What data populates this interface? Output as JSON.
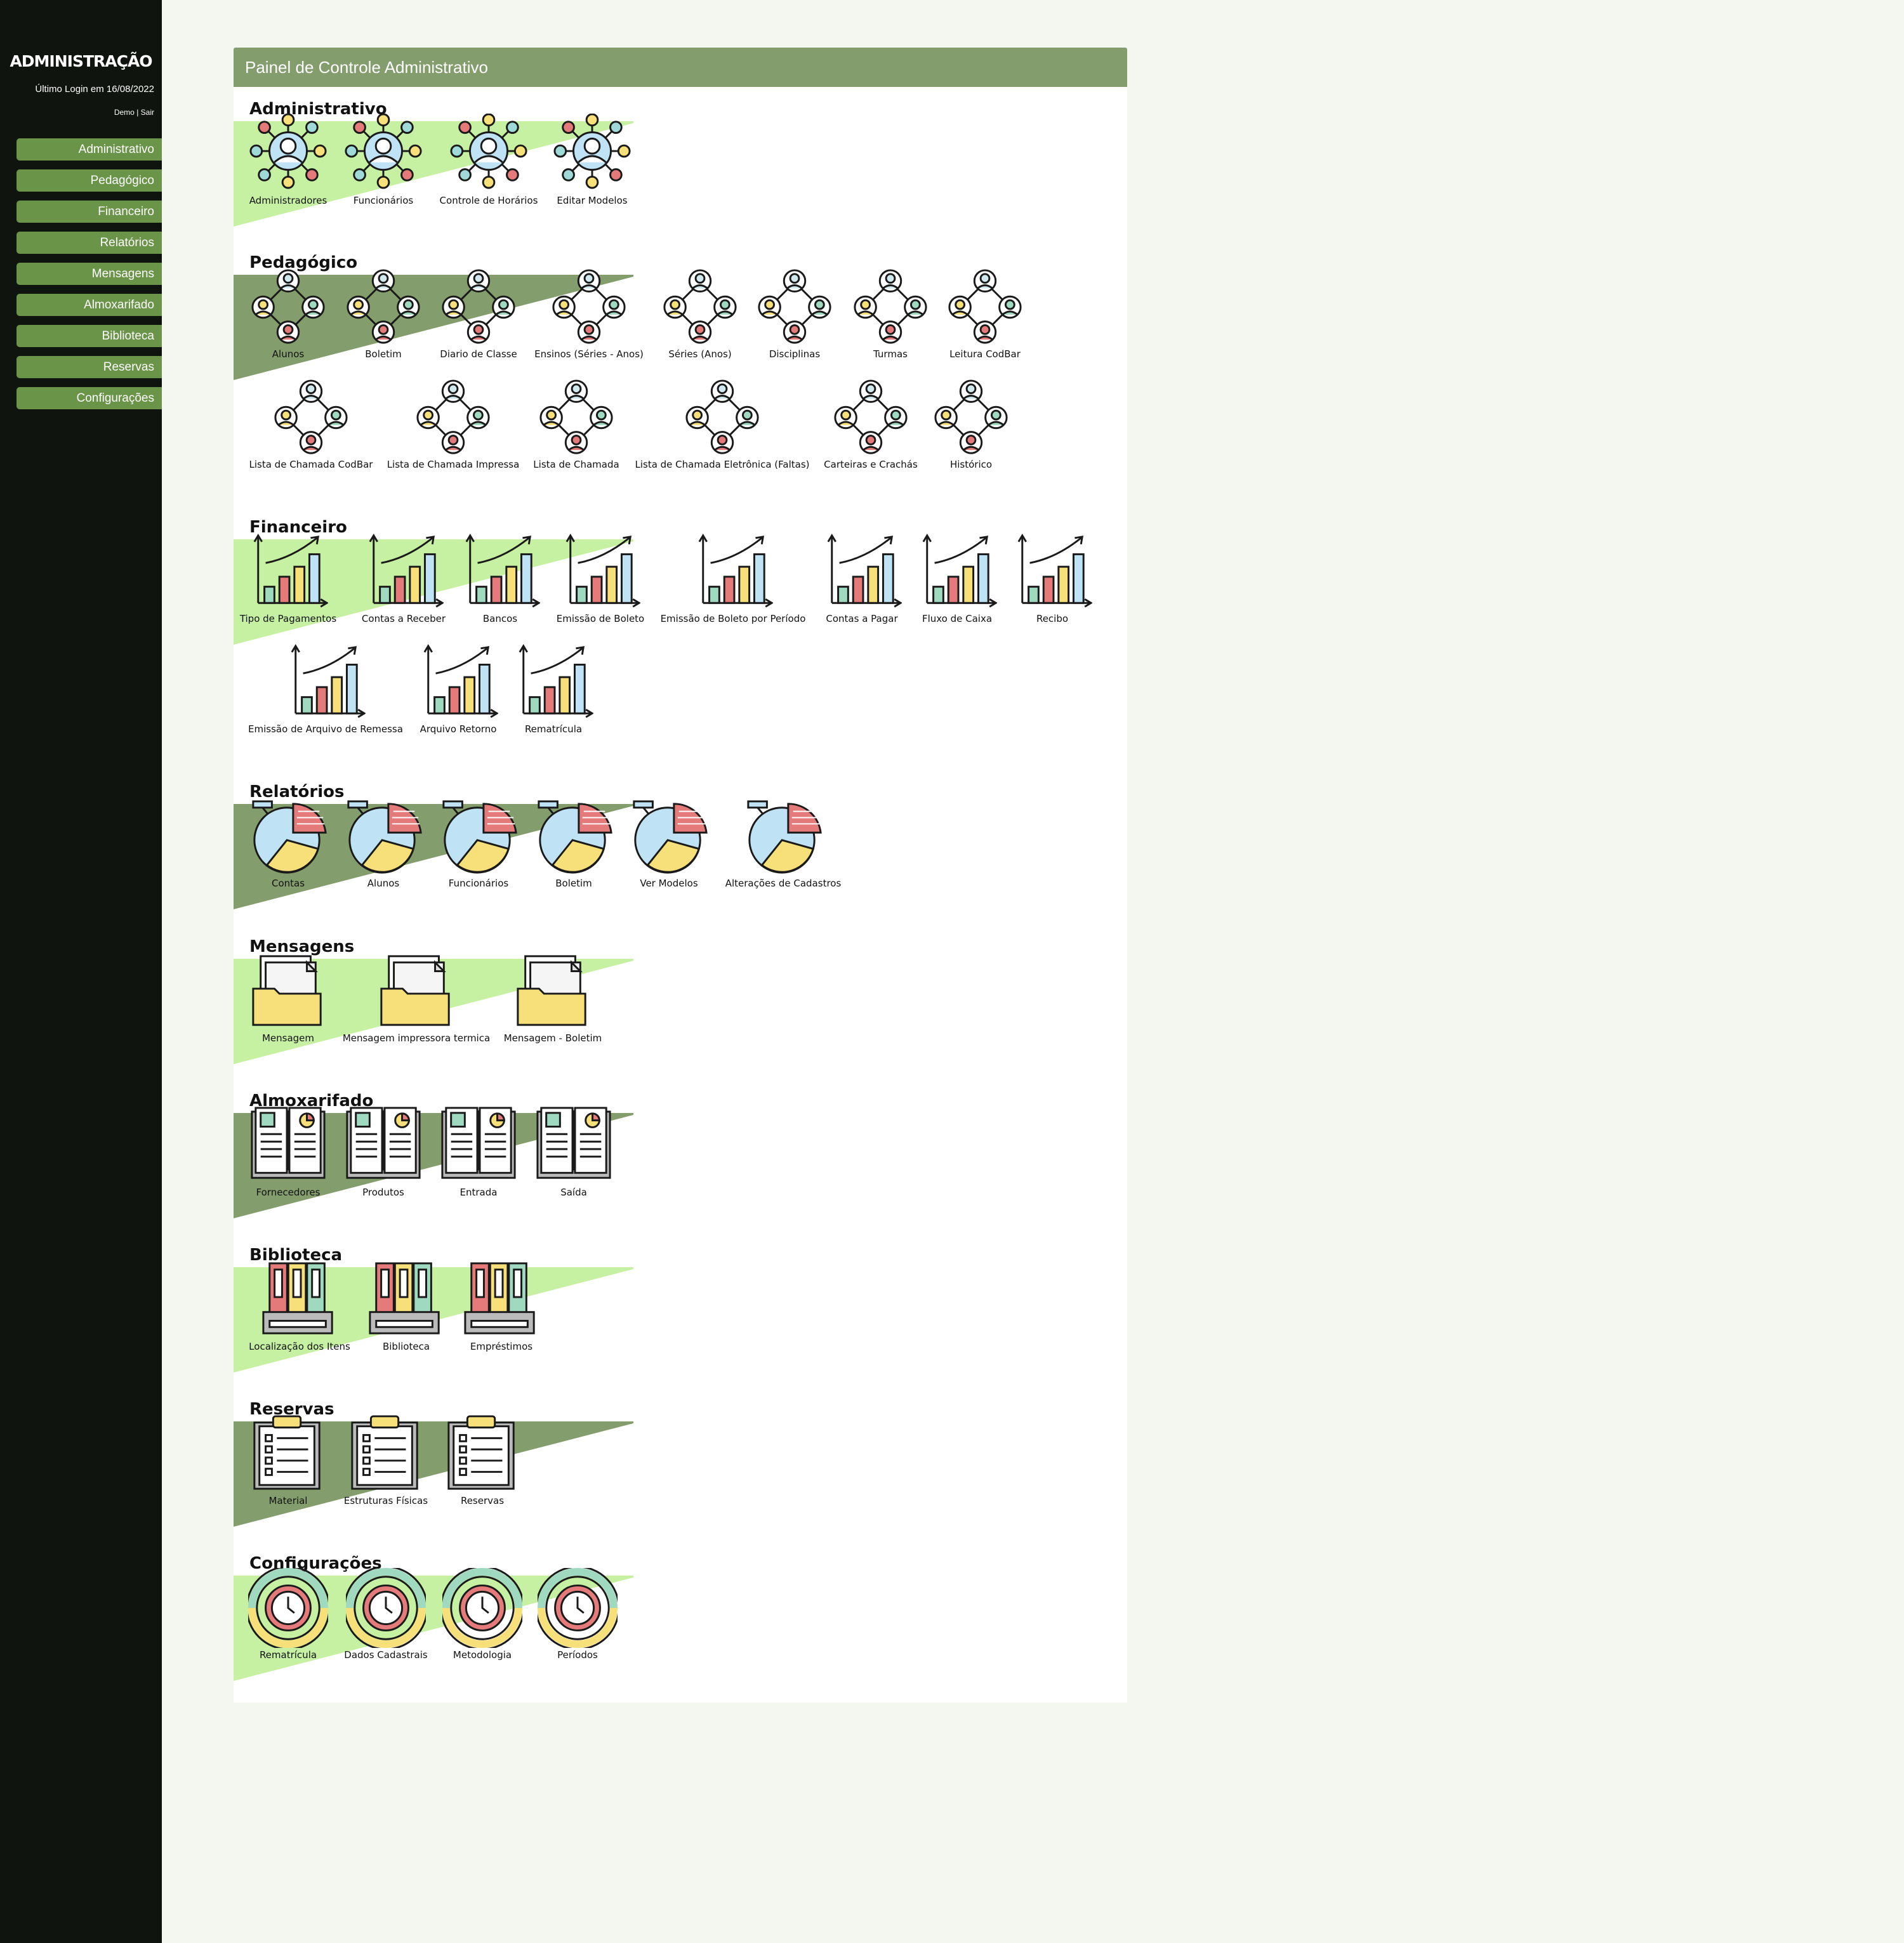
{
  "sidebar": {
    "brand": "ADMINISTRAÇÃO",
    "last_login": "Último Login em 16/08/2022",
    "user": "Demo",
    "separator": " | ",
    "logout": "Sair",
    "items": [
      "Administrativo",
      "Pedagógico",
      "Financeiro",
      "Relatórios",
      "Mensagens",
      "Almoxarifado",
      "Biblioteca",
      "Reservas",
      "Configurações"
    ]
  },
  "panel": {
    "title": "Painel de Controle Administrativo"
  },
  "colors": {
    "sidebar_bg": "#0f150e",
    "nav_button": "#6a9448",
    "panel_header": "#839d6c",
    "banner_light": "#c6f0a2",
    "banner_dark": "#839d6c",
    "page_bg": "#f3f7f0"
  },
  "sections": [
    {
      "title": "Administrativo",
      "style": "light",
      "icon": "network-users-icon",
      "items": [
        "Administradores",
        "Funcionários",
        "Controle de Horários",
        "Editar Modelos"
      ]
    },
    {
      "title": "Pedagógico",
      "style": "dark",
      "icon": "group-users-icon",
      "items": [
        "Alunos",
        "Boletim",
        "Diario de Classe",
        "Ensinos (Séries - Anos)",
        "Séries (Anos)",
        "Disciplinas",
        "Turmas",
        "Leitura CodBar",
        "Lista de Chamada CodBar",
        "Lista de Chamada Impressa",
        "Lista de Chamada",
        "Lista de Chamada Eletrônica (Faltas)",
        "Carteiras e Crachás",
        "Histórico"
      ]
    },
    {
      "title": "Financeiro",
      "style": "light",
      "icon": "bar-chart-growth-icon",
      "items": [
        "Tipo de Pagamentos",
        "Contas a Receber",
        "Bancos",
        "Emissão de Boleto",
        "Emissão de Boleto por Período",
        "Contas a Pagar",
        "Fluxo de Caixa",
        "Recibo",
        "Emissão de Arquivo de Remessa",
        "Arquivo Retorno",
        "Rematrícula"
      ]
    },
    {
      "title": "Relatórios",
      "style": "dark",
      "icon": "pie-chart-icon",
      "items": [
        "Contas",
        "Alunos",
        "Funcionários",
        "Boletim",
        "Ver Modelos",
        "Alterações de Cadastros"
      ]
    },
    {
      "title": "Mensagens",
      "style": "light",
      "icon": "folder-documents-icon",
      "items": [
        "Mensagem",
        "Mensagem impressora termica",
        "Mensagem - Boletim"
      ]
    },
    {
      "title": "Almoxarifado",
      "style": "dark",
      "icon": "open-book-report-icon",
      "items": [
        "Fornecedores",
        "Produtos",
        "Entrada",
        "Saída"
      ]
    },
    {
      "title": "Biblioteca",
      "style": "light",
      "icon": "binders-shelf-icon",
      "items": [
        "Localização dos Itens",
        "Biblioteca",
        "Empréstimos"
      ]
    },
    {
      "title": "Reservas",
      "style": "dark",
      "icon": "clipboard-checklist-icon",
      "items": [
        "Material",
        "Estruturas Físicas",
        "Reservas"
      ]
    },
    {
      "title": "Configurações",
      "style": "light",
      "icon": "clock-cycle-icon",
      "items": [
        "Rematrícula",
        "Dados Cadastrais",
        "Metodologia",
        "Períodos"
      ]
    }
  ]
}
